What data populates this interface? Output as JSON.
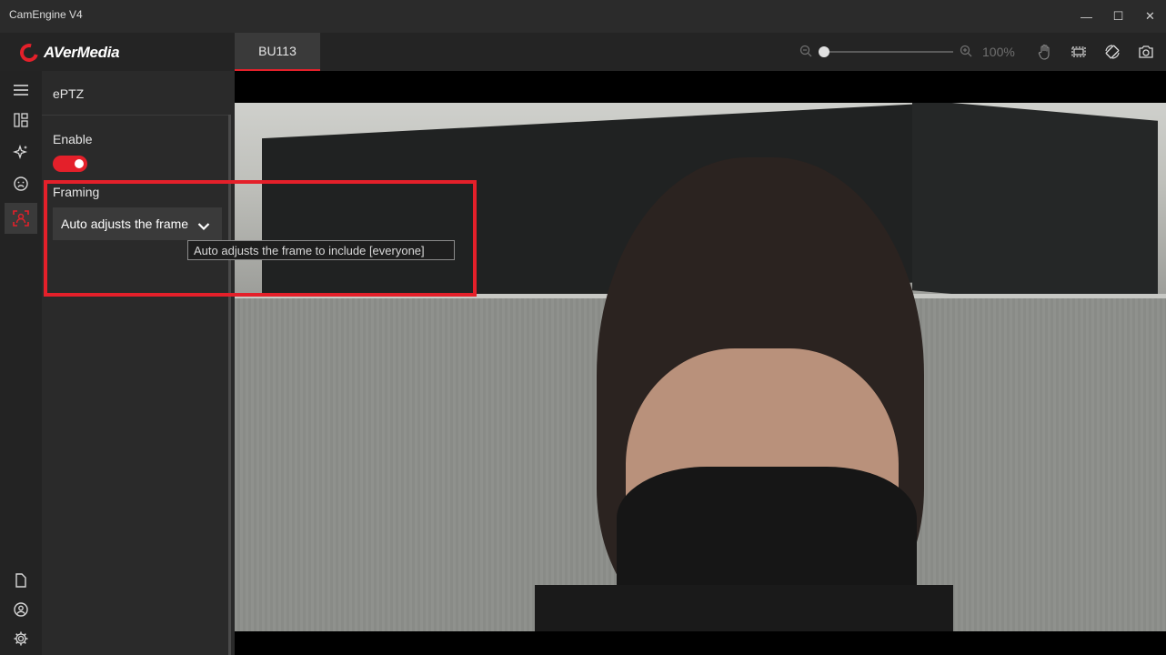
{
  "window": {
    "title": "CamEngine V4",
    "minimize": "—",
    "maximize": "☐",
    "close": "✕"
  },
  "header": {
    "brand": "AVerMedia",
    "camera_tab": "BU113",
    "zoom_out_icon": "zoom-out-icon",
    "zoom_in_icon": "zoom-in-icon",
    "zoom_level": "100%",
    "zoom_fraction": 0,
    "tools": [
      "hand-pan-icon",
      "fit-frame-icon",
      "rotate-icon",
      "snapshot-camera-icon"
    ]
  },
  "rail": {
    "items": [
      "menu-icon",
      "layout-icon",
      "effects-sparkle-icon",
      "face-icon",
      "eptz-framing-icon"
    ],
    "bottom_items": [
      "document-icon",
      "account-icon",
      "settings-gear-icon"
    ],
    "active_item": "eptz-framing-icon"
  },
  "panel": {
    "title": "ePTZ",
    "enable_label": "Enable",
    "enable_on": true,
    "framing_label": "Framing",
    "framing_value": "Auto adjusts the frame",
    "tooltip": "Auto adjusts the frame to include [everyone]"
  },
  "colors": {
    "accent": "#e4202a",
    "background": "#1c1c1c",
    "panel": "#2a2a2a"
  }
}
